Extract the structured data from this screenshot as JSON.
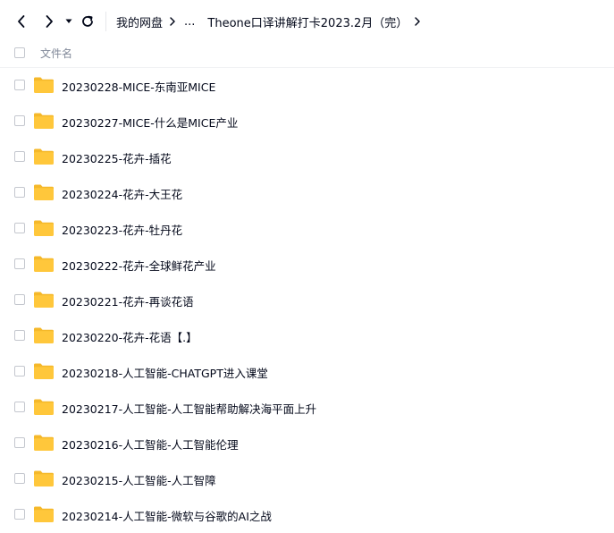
{
  "nav": {
    "back_icon": "chevron-left-icon",
    "forward_icon": "chevron-right-icon",
    "dropdown_icon": "caret-down-icon",
    "refresh_icon": "refresh-icon"
  },
  "breadcrumb": {
    "root": "我的网盘",
    "ellipsis": "...",
    "current": "Theone口译讲解打卡2023.2月（完）"
  },
  "list_header": {
    "column_name": "文件名"
  },
  "files": [
    {
      "name": "20230228-MICE-东南亚MICE",
      "icon": "folder-icon"
    },
    {
      "name": "20230227-MICE-什么是MICE产业",
      "icon": "folder-icon"
    },
    {
      "name": "20230225-花卉-插花",
      "icon": "folder-icon"
    },
    {
      "name": "20230224-花卉-大王花",
      "icon": "folder-icon"
    },
    {
      "name": "20230223-花卉-牡丹花",
      "icon": "folder-icon"
    },
    {
      "name": "20230222-花卉-全球鲜花产业",
      "icon": "folder-icon"
    },
    {
      "name": "20230221-花卉-再谈花语",
      "icon": "folder-icon"
    },
    {
      "name": "20230220-花卉-花语【.】",
      "icon": "folder-icon"
    },
    {
      "name": "20230218-人工智能-CHATGPT进入课堂",
      "icon": "folder-icon"
    },
    {
      "name": "20230217-人工智能-人工智能帮助解决海平面上升",
      "icon": "folder-icon"
    },
    {
      "name": "20230216-人工智能-人工智能伦理",
      "icon": "folder-icon"
    },
    {
      "name": "20230215-人工智能-人工智障",
      "icon": "folder-icon"
    },
    {
      "name": "20230214-人工智能-微软与谷歌的AI之战",
      "icon": "folder-icon"
    }
  ],
  "colors": {
    "folder": "#ffc73b",
    "folder_tab": "#f5b82a",
    "text": "#03081a",
    "muted": "#818999"
  }
}
